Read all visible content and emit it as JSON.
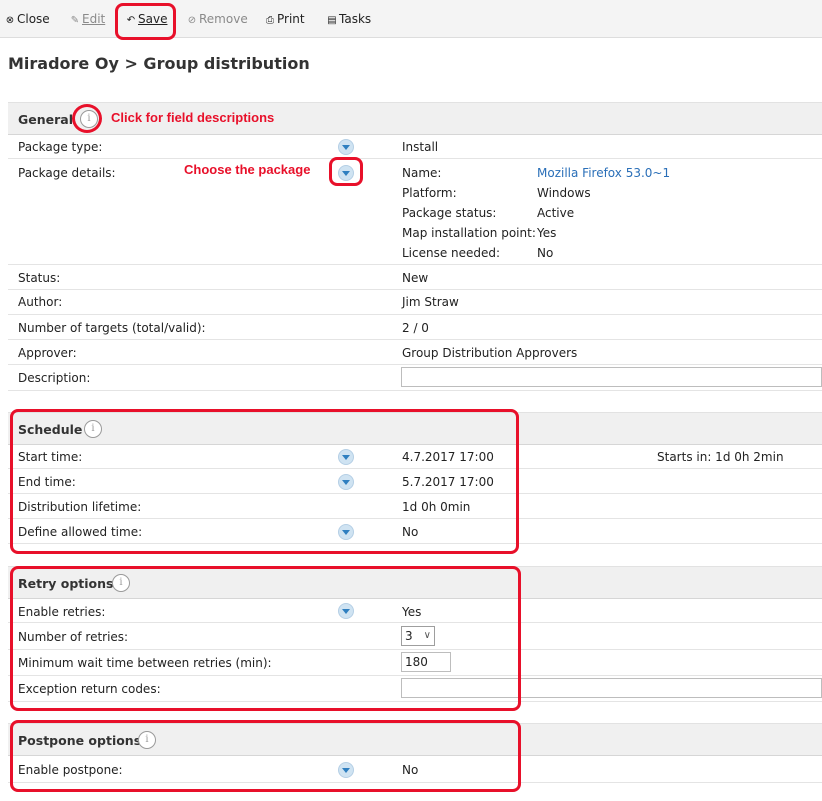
{
  "toolbar": {
    "close": "Close",
    "edit": "Edit",
    "save": "Save",
    "remove": "Remove",
    "print": "Print",
    "tasks": "Tasks"
  },
  "page_title": "Miradore Oy > Group distribution",
  "annotations": {
    "field_descriptions": "Click for field descriptions",
    "choose_package": "Choose the package",
    "color": "#e8102a"
  },
  "general": {
    "title": "General",
    "package_type_label": "Package type:",
    "package_type_value": "Install",
    "package_details_label": "Package details:",
    "details": [
      {
        "label": "Name:",
        "value": "Mozilla Firefox 53.0~1"
      },
      {
        "label": "Platform:",
        "value": "Windows"
      },
      {
        "label": "Package status:",
        "value": "Active"
      },
      {
        "label": "Map installation point:",
        "value": "Yes"
      },
      {
        "label": "License needed:",
        "value": "No"
      }
    ],
    "status_label": "Status:",
    "status_value": "New",
    "author_label": "Author:",
    "author_value": "Jim Straw",
    "targets_label": "Number of targets (total/valid):",
    "targets_value": "2 / 0",
    "approver_label": "Approver:",
    "approver_value": "Group Distribution Approvers",
    "description_label": "Description:",
    "description_value": ""
  },
  "schedule": {
    "title": "Schedule",
    "start_label": "Start time:",
    "start_value": "4.7.2017 17:00",
    "starts_in": "Starts in: 1d 0h 2min",
    "end_label": "End time:",
    "end_value": "5.7.2017 17:00",
    "lifetime_label": "Distribution lifetime:",
    "lifetime_value": "1d 0h 0min",
    "allowed_label": "Define allowed time:",
    "allowed_value": "No"
  },
  "retry": {
    "title": "Retry options",
    "enable_label": "Enable retries:",
    "enable_value": "Yes",
    "count_label": "Number of retries:",
    "count_value": "3",
    "wait_label": "Minimum wait time between retries (min):",
    "wait_value": "180",
    "codes_label": "Exception return codes:",
    "codes_value": ""
  },
  "postpone": {
    "title": "Postpone options",
    "enable_label": "Enable postpone:",
    "enable_value": "No"
  },
  "icons": {
    "info": "i",
    "dropdown": "chevron-down-icon",
    "select_chevron": "∨"
  }
}
